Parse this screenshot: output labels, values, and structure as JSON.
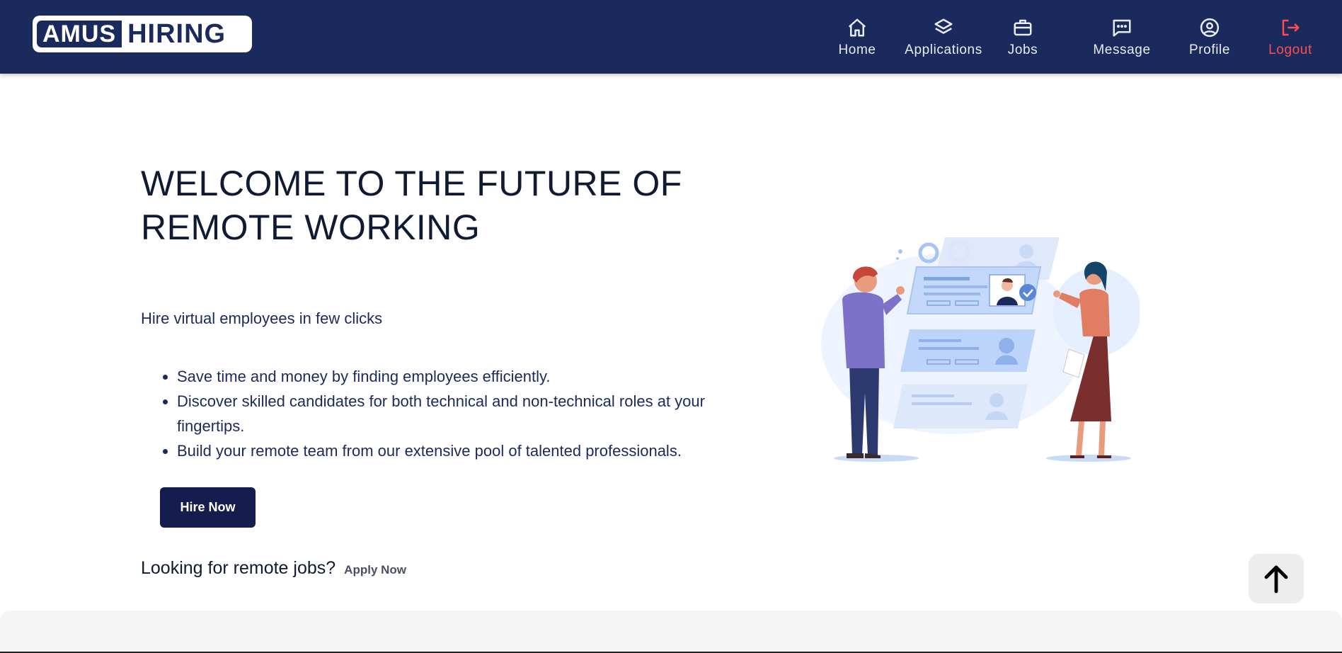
{
  "brand": {
    "logo_left": "AMUS",
    "logo_right": "HIRING"
  },
  "nav": {
    "home": "Home",
    "applications": "Applications",
    "jobs": "Jobs",
    "message": "Message",
    "profile": "Profile",
    "logout": "Logout"
  },
  "hero": {
    "title": "WELCOME TO THE FUTURE OF REMOTE WORKING",
    "subtitle": "Hire virtual employees in few clicks",
    "bullets": [
      "Save time and money by finding employees efficiently.",
      "Discover skilled candidates for both technical and non-technical roles at your fingertips.",
      "Build your remote team from our extensive pool of talented professionals."
    ],
    "hire_button": "Hire Now",
    "looking_text": "Looking for remote jobs?",
    "apply_link": "Apply Now"
  },
  "icons": {
    "home": "home-icon",
    "applications": "layers-icon",
    "jobs": "briefcase-icon",
    "message": "message-icon",
    "profile": "user-circle-icon",
    "logout": "logout-icon",
    "scroll_top": "arrow-up-icon"
  },
  "colors": {
    "header_bg": "#1b2a5c",
    "button_bg": "#141d4e",
    "logout": "#ff4d4d"
  }
}
